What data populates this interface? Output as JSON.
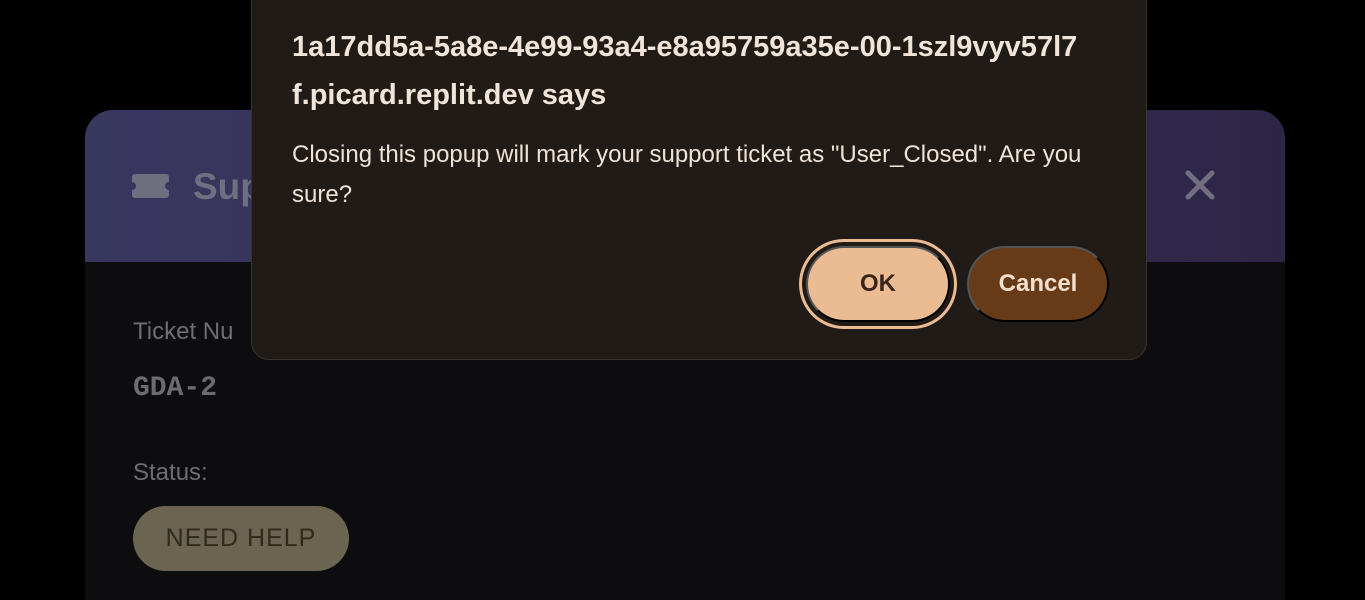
{
  "ticket": {
    "title": "Sup",
    "number_label": "Ticket Nu",
    "number_value": "GDA-2",
    "status_label": "Status:",
    "status_value": "NEED HELP"
  },
  "dialog": {
    "origin": "1a17dd5a-5a8e-4e99-93a4-e8a95759a35e-00-1szl9vyv57l7f.picard.replit.dev says",
    "message": "Closing this popup will mark your support ticket as \"User_Closed\". Are you sure?",
    "ok_label": "OK",
    "cancel_label": "Cancel"
  },
  "icons": {
    "ticket": "ticket-icon",
    "close": "close-icon"
  },
  "colors": {
    "header_gradient_start": "#38375e",
    "header_gradient_end": "#2e2546",
    "dialog_bg": "#201b17",
    "ok_bg": "#ebbc94",
    "cancel_bg": "#683b18",
    "status_badge_bg": "#6a6450"
  }
}
